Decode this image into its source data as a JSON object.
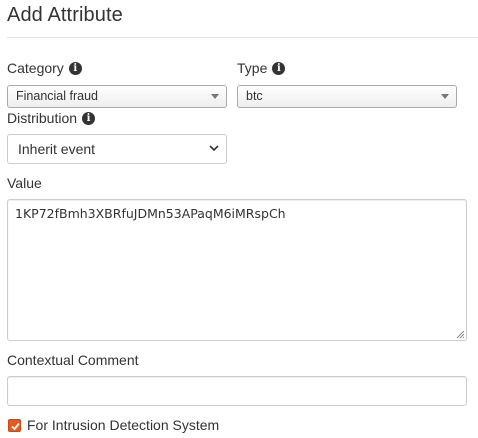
{
  "form": {
    "title": "Add Attribute",
    "category": {
      "label": "Category",
      "value": "Financial fraud"
    },
    "type": {
      "label": "Type",
      "value": "btc"
    },
    "distribution": {
      "label": "Distribution",
      "value": "Inherit event"
    },
    "value": {
      "label": "Value",
      "text": "1KP72fBmh3XBRfuJDMn53APaqM6iMRspCh"
    },
    "comment": {
      "label": "Contextual Comment",
      "value": ""
    },
    "ids": {
      "label": "For Intrusion Detection System",
      "checked": true
    }
  },
  "colors": {
    "checkbox_accent": "#e65a1f"
  },
  "icons": [
    "info-icon",
    "caret-down-icon",
    "chevron-down-icon",
    "resize-handle-icon",
    "checkmark-icon"
  ]
}
